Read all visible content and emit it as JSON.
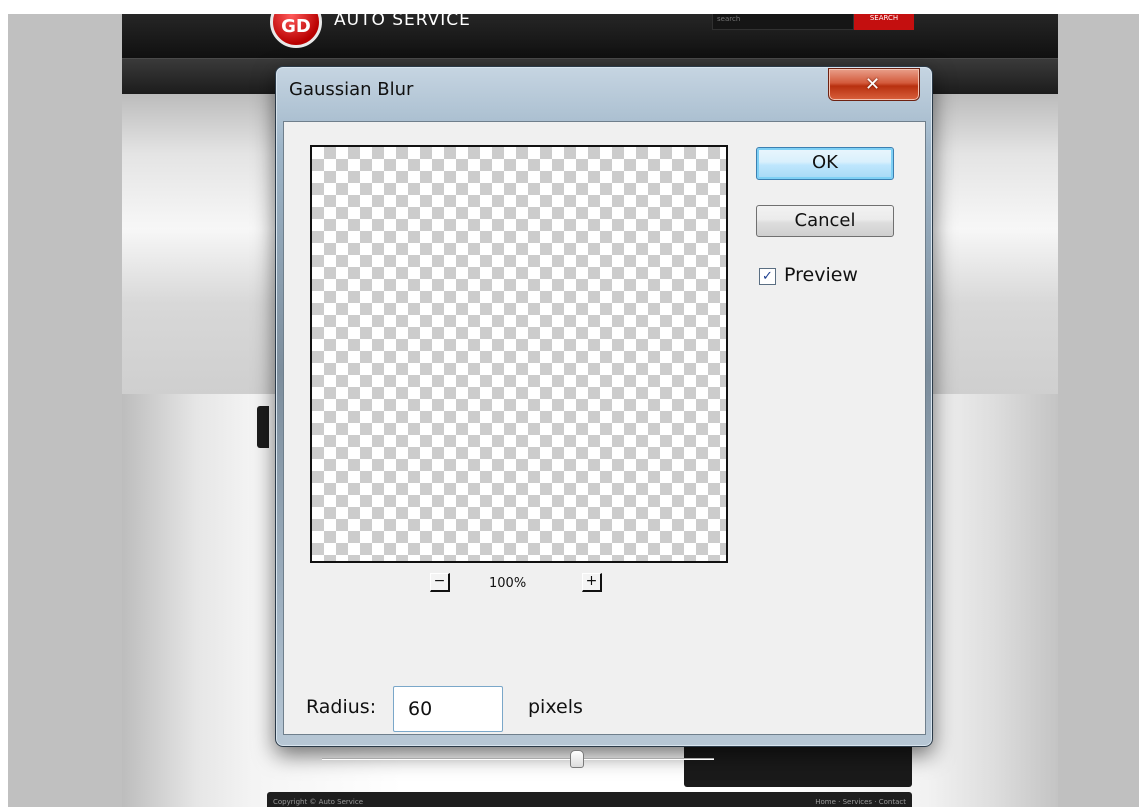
{
  "website": {
    "logo_badge": "GD",
    "logo_text": "AUTO SERVICE",
    "search_placeholder": "search",
    "search_button": "SEARCH",
    "footer_left": "Copyright © Auto Service",
    "footer_right": "Home · Services · Contact"
  },
  "dialog": {
    "title": "Gaussian Blur",
    "close_icon": "close-x-icon",
    "ok_label": "OK",
    "cancel_label": "Cancel",
    "preview_checkbox": {
      "label": "Preview",
      "checked": true,
      "check_glyph": "✓"
    },
    "zoom": {
      "out_symbol": "−",
      "in_symbol": "+",
      "level": "100%"
    },
    "radius": {
      "label": "Radius:",
      "value": "60",
      "unit": "pixels"
    },
    "slider": {
      "fraction": 0.65
    }
  },
  "colors": {
    "ok_accent": "#7ed0f5",
    "close_red": "#c8482a",
    "site_accent": "#c40f0f"
  }
}
